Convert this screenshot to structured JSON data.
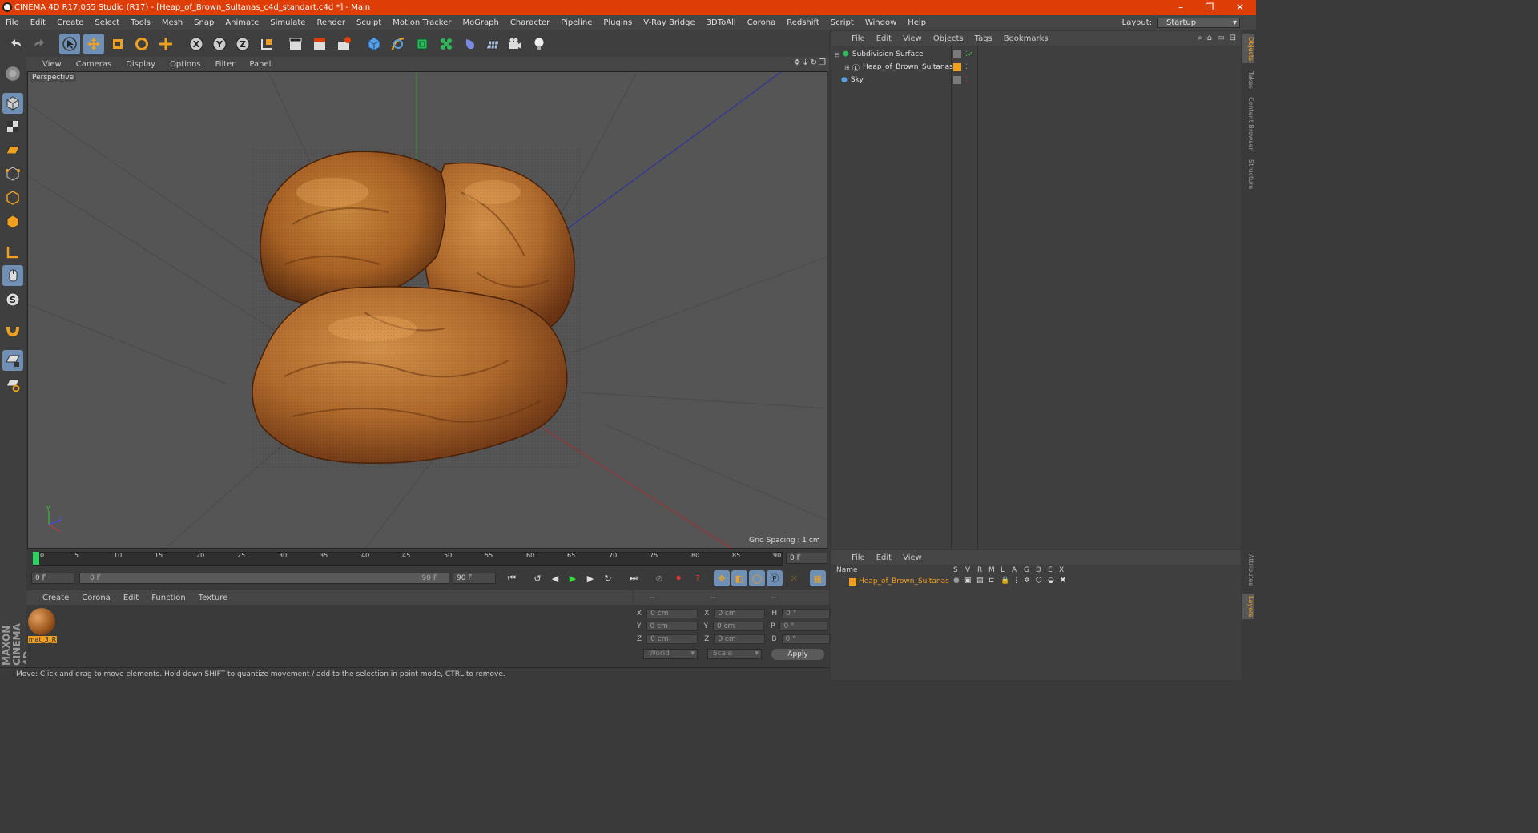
{
  "title_bar": {
    "title": "CINEMA 4D R17.055 Studio (R17) - [Heap_of_Brown_Sultanas_c4d_standart.c4d *] - Main",
    "minimize": "–",
    "maximize": "❐",
    "close": "✕"
  },
  "menu": {
    "items": [
      "File",
      "Edit",
      "Create",
      "Select",
      "Tools",
      "Mesh",
      "Snap",
      "Animate",
      "Simulate",
      "Render",
      "Sculpt",
      "Motion Tracker",
      "MoGraph",
      "Character",
      "Pipeline",
      "Plugins",
      "V-Ray Bridge",
      "3DToAll",
      "Corona",
      "Redshift",
      "Script",
      "Window",
      "Help"
    ],
    "layout_label": "Layout:",
    "layout_value": "Startup"
  },
  "viewport": {
    "menu": [
      "View",
      "Cameras",
      "Display",
      "Options",
      "Filter",
      "Panel"
    ],
    "label": "Perspective",
    "grid_spacing": "Grid Spacing : 1 cm"
  },
  "timeline": {
    "ticks": [
      "0",
      "5",
      "10",
      "15",
      "20",
      "25",
      "30",
      "35",
      "40",
      "45",
      "50",
      "55",
      "60",
      "65",
      "70",
      "75",
      "80",
      "85",
      "90"
    ],
    "current_frame": "0 F",
    "start_field": "0 F",
    "range_start": "0 F",
    "range_end": "90 F",
    "end_field": "90 F"
  },
  "material_manager": {
    "menu": [
      "Create",
      "Corona",
      "Edit",
      "Function",
      "Texture"
    ],
    "material_name": "mat_3_R"
  },
  "coordinates": {
    "header": [
      "--",
      "--",
      "--"
    ],
    "rows": [
      {
        "a": "X",
        "av": "0 cm",
        "b": "X",
        "bv": "0 cm",
        "c": "H",
        "cv": "0 °"
      },
      {
        "a": "Y",
        "av": "0 cm",
        "b": "Y",
        "bv": "0 cm",
        "c": "P",
        "cv": "0 °"
      },
      {
        "a": "Z",
        "av": "0 cm",
        "b": "Z",
        "bv": "0 cm",
        "c": "B",
        "cv": "0 °"
      }
    ],
    "world": "World",
    "scale": "Scale",
    "apply": "Apply"
  },
  "object_manager": {
    "menu": [
      "File",
      "Edit",
      "View",
      "Objects",
      "Tags",
      "Bookmarks"
    ],
    "objects": [
      "Subdivision Surface",
      "Heap_of_Brown_Sultanas",
      "Sky"
    ]
  },
  "layer_manager": {
    "menu": [
      "File",
      "Edit",
      "View"
    ],
    "name_header": "Name",
    "cols": [
      "S",
      "V",
      "R",
      "M",
      "L",
      "A",
      "G",
      "D",
      "E",
      "X"
    ],
    "layer_name": "Heap_of_Brown_Sultanas"
  },
  "right_tabs": [
    "Objects",
    "Takes",
    "Content Browser",
    "Structure",
    "Attributes",
    "Layers"
  ],
  "brand": "MAXON CINEMA 4D",
  "status": "Move: Click and drag to move elements. Hold down SHIFT to quantize movement / add to the selection in point mode, CTRL to remove.",
  "colors": {
    "title_bar": "#de3e06",
    "accent": "#f0a020",
    "active_tool": "#6f8fb5"
  }
}
